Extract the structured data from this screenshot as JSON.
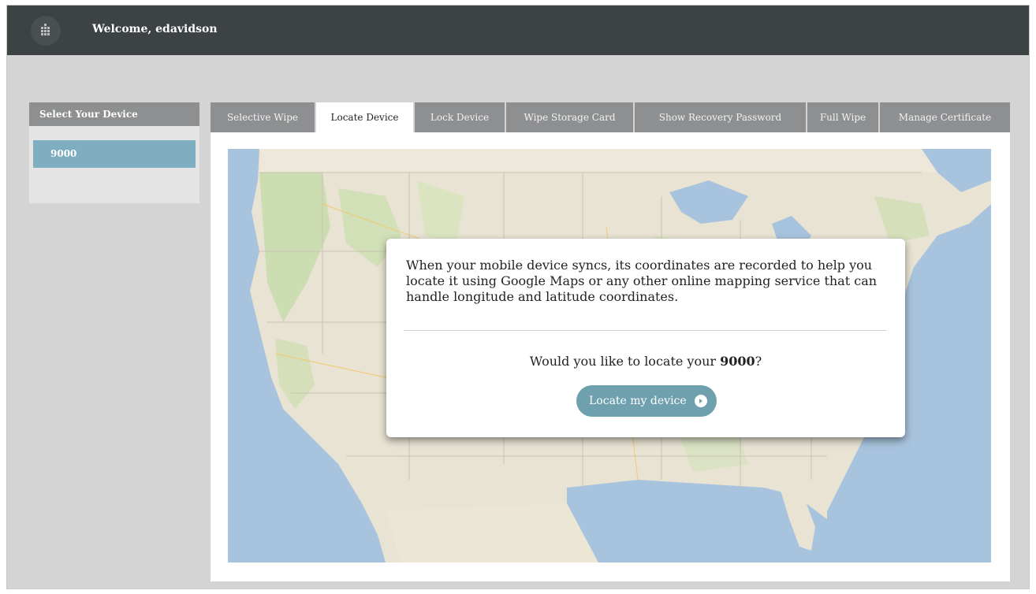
{
  "header": {
    "welcome": "Welcome, edavidson"
  },
  "device_panel": {
    "title": "Select Your Device",
    "devices": [
      "9000"
    ]
  },
  "tabs": [
    "Selective Wipe",
    "Locate Device",
    "Lock Device",
    "Wipe Storage Card",
    "Show Recovery Password",
    "Full Wipe",
    "Manage Certificate"
  ],
  "active_tab": "Locate Device",
  "dialog": {
    "description": "When your mobile device syncs, its coordinates are recorded to help you locate it using Google Maps or any other online mapping service that can handle longitude and latitude coordinates.",
    "question_prefix": "Would you like to locate your ",
    "device": "9000",
    "question_suffix": "?",
    "button_label": "Locate my device"
  },
  "icons": {
    "logo": "building-icon",
    "button_arrow": "arrow-right-icon"
  },
  "colors": {
    "topbar": "#3d4245",
    "selected_device": "#7faec0",
    "button": "#6fa0ae",
    "tab": "#8d8f91"
  }
}
